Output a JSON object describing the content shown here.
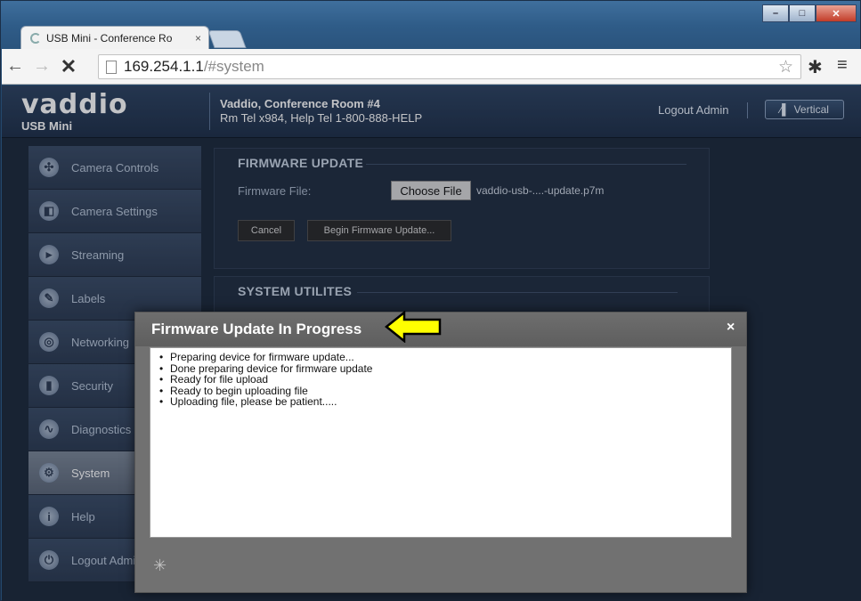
{
  "browser": {
    "tab_title": "USB Mini - Conference Ro",
    "tab_close": "×",
    "url_host": "169.254.1.1",
    "url_path": "/#system",
    "nav_back": "←",
    "nav_forward": "→",
    "nav_stop": "✕",
    "star": "☆",
    "settings": "✱",
    "menu": "≡",
    "window_controls": {
      "minimize": "–",
      "maximize": "□",
      "close": "✕"
    }
  },
  "header": {
    "logo_word": "vaddio",
    "logo_model": "USB Mini",
    "site_name": "Vaddio, Conference Room #4",
    "site_contact": "Rm Tel x984, Help Tel 1-800-888-HELP",
    "logout_label": "Logout Admin",
    "vertical_label": "Vertical"
  },
  "sidebar": {
    "items": [
      {
        "label": "Camera Controls",
        "icon": "camera-controls-icon",
        "glyph": "✣"
      },
      {
        "label": "Camera Settings",
        "icon": "camera-settings-icon",
        "glyph": "◧"
      },
      {
        "label": "Streaming",
        "icon": "streaming-icon",
        "glyph": "▸"
      },
      {
        "label": "Labels",
        "icon": "labels-icon",
        "glyph": "✎"
      },
      {
        "label": "Networking",
        "icon": "networking-icon",
        "glyph": "◎"
      },
      {
        "label": "Security",
        "icon": "security-icon",
        "glyph": "▮"
      },
      {
        "label": "Diagnostics",
        "icon": "diagnostics-icon",
        "glyph": "∿"
      },
      {
        "label": "System",
        "icon": "system-icon",
        "glyph": "⚙",
        "active": true
      },
      {
        "label": "Help",
        "icon": "help-icon",
        "glyph": "i"
      },
      {
        "label": "Logout Admin",
        "icon": "logout-icon",
        "glyph": "⏻"
      }
    ]
  },
  "firmware_panel": {
    "title": "FIRMWARE UPDATE",
    "file_label": "Firmware File:",
    "choose_button": "Choose File",
    "file_name": "vaddio-usb-....-update.p7m",
    "cancel_button": "Cancel",
    "begin_button": "Begin Firmware Update..."
  },
  "utilities_panel": {
    "title": "SYSTEM UTILITES"
  },
  "modal": {
    "title": "Firmware Update In Progress",
    "close": "×",
    "log": [
      "Preparing device for firmware update...",
      "Done preparing device for firmware update",
      "Ready for file upload",
      "Ready to begin uploading file",
      "Uploading file, please be patient....."
    ],
    "spinner": "✳"
  },
  "colors": {
    "callout_arrow": "#ffff00",
    "app_background": "#1d2a3b",
    "modal_background": "#717171"
  }
}
